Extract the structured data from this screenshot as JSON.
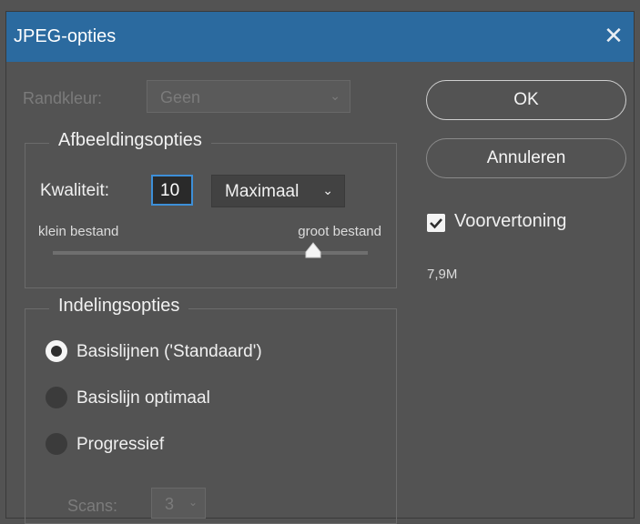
{
  "window": {
    "title": "JPEG-opties",
    "close_glyph": "✕"
  },
  "randkleur": {
    "label": "Randkleur:",
    "value": "Geen",
    "chevron": "⌄"
  },
  "afbeeldingsopties": {
    "legend": "Afbeeldingsopties",
    "kwaliteit_label": "Kwaliteit:",
    "kwaliteit_value": "10",
    "preset_value": "Maximaal",
    "preset_chevron": "⌄",
    "slider_left_label": "klein bestand",
    "slider_right_label": "groot bestand",
    "slider_fraction": 0.83
  },
  "indelingsopties": {
    "legend": "Indelingsopties",
    "options": [
      {
        "label": "Basislijnen ('Standaard')",
        "checked": true
      },
      {
        "label": "Basislijn optimaal",
        "checked": false
      },
      {
        "label": "Progressief",
        "checked": false
      }
    ],
    "scans_label": "Scans:",
    "scans_value": "3",
    "scans_chevron": "⌄"
  },
  "buttons": {
    "ok": "OK",
    "cancel": "Annuleren"
  },
  "preview": {
    "label": "Voorvertoning",
    "checked": true
  },
  "file_size": "7,9M",
  "colors": {
    "titlebar": "#2b6a9f",
    "dialog_bg": "#535353",
    "focus": "#3d8fd8"
  }
}
